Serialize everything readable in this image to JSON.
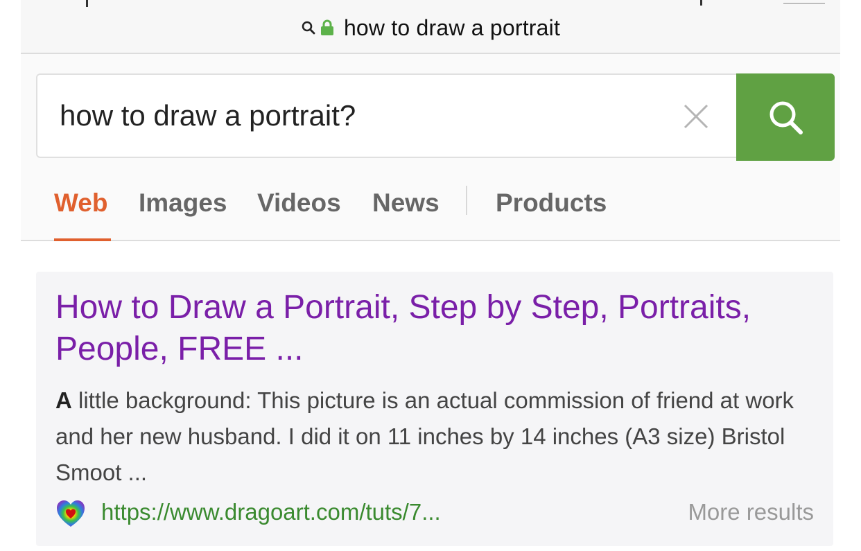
{
  "browser": {
    "address_text": "how to draw a portrait",
    "icons": [
      "search-icon",
      "lock-icon"
    ],
    "lock_color": "#5db24a"
  },
  "search": {
    "query": "how to draw a portrait?",
    "clear_icon": "close-icon",
    "button_icon": "search-icon",
    "button_color": "#60a143"
  },
  "tabs": {
    "items": [
      {
        "label": "Web",
        "active": true
      },
      {
        "label": "Images",
        "active": false
      },
      {
        "label": "Videos",
        "active": false
      },
      {
        "label": "News",
        "active": false
      },
      {
        "label": "Products",
        "active": false
      }
    ],
    "active_color": "#e0602e"
  },
  "result": {
    "title": "How to Draw a Portrait, Step by Step, Portraits, People, FREE ...",
    "snippet_lead": "A",
    "snippet_rest": " little background: This picture is an actual commission of friend at work and her new husband. I did it on 11 inches by 14 inches (A3 size) Bristol Smoot ...",
    "favicon": "heart-favicon-icon",
    "url": "https://www.dragoart.com/tuts/7...",
    "more_results": "More results",
    "title_color": "#7a1fa8",
    "url_color": "#3a8a2f"
  }
}
